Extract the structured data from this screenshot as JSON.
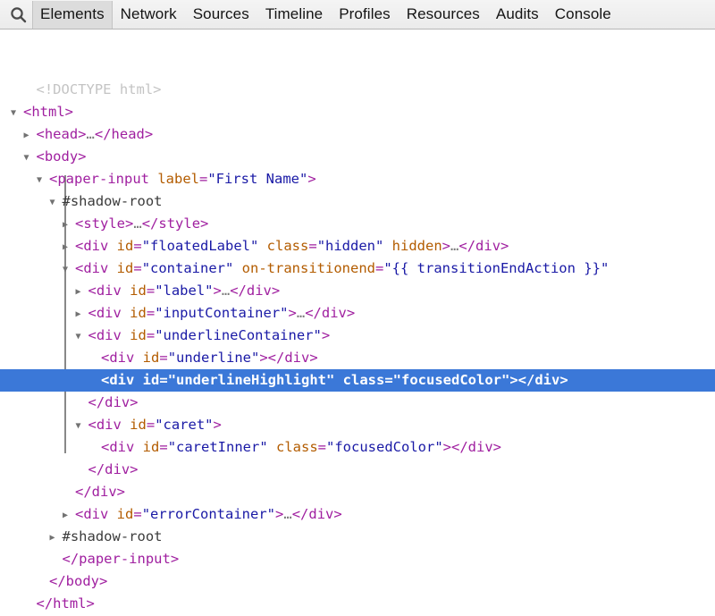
{
  "toolbar": {
    "search_icon": "search-icon",
    "tabs": [
      {
        "label": "Elements",
        "active": true
      },
      {
        "label": "Network",
        "active": false
      },
      {
        "label": "Sources",
        "active": false
      },
      {
        "label": "Timeline",
        "active": false
      },
      {
        "label": "Profiles",
        "active": false
      },
      {
        "label": "Resources",
        "active": false
      },
      {
        "label": "Audits",
        "active": false
      },
      {
        "label": "Console",
        "active": false
      }
    ]
  },
  "colors": {
    "selection_blue": "#3b78d8",
    "tag": "#a020a0",
    "attr_name": "#b35c00",
    "attr_value": "#1a1aa6",
    "doctype_gray": "#c4c4c4",
    "toolbar_bg": "#efefef",
    "active_tab_bg": "#dcdcdc"
  },
  "dom_tree": {
    "lines": [
      {
        "twisty": "",
        "indent": 1,
        "selected": false,
        "parts": [
          {
            "t": "doctype",
            "v": "<!DOCTYPE html>"
          }
        ]
      },
      {
        "twisty": "open",
        "indent": 0,
        "selected": false,
        "parts": [
          {
            "t": "punct",
            "v": "<"
          },
          {
            "t": "tag",
            "v": "html"
          },
          {
            "t": "punct",
            "v": ">"
          }
        ]
      },
      {
        "twisty": "closed",
        "indent": 1,
        "selected": false,
        "parts": [
          {
            "t": "punct",
            "v": "<"
          },
          {
            "t": "tag",
            "v": "head"
          },
          {
            "t": "punct",
            "v": ">"
          },
          {
            "t": "ellipsis",
            "v": "…"
          },
          {
            "t": "punct",
            "v": "</"
          },
          {
            "t": "tag",
            "v": "head"
          },
          {
            "t": "punct",
            "v": ">"
          }
        ]
      },
      {
        "twisty": "open",
        "indent": 1,
        "selected": false,
        "parts": [
          {
            "t": "punct",
            "v": "<"
          },
          {
            "t": "tag",
            "v": "body"
          },
          {
            "t": "punct",
            "v": ">"
          }
        ]
      },
      {
        "twisty": "open",
        "indent": 2,
        "selected": false,
        "parts": [
          {
            "t": "punct",
            "v": "<"
          },
          {
            "t": "tag",
            "v": "paper-input"
          },
          {
            "t": "attr-name",
            "v": " label"
          },
          {
            "t": "punct",
            "v": "="
          },
          {
            "t": "attr-value",
            "v": "\"First Name\""
          },
          {
            "t": "punct",
            "v": ">"
          }
        ]
      },
      {
        "twisty": "open",
        "indent": 3,
        "selected": false,
        "parts": [
          {
            "t": "shadow",
            "v": "#shadow-root"
          }
        ]
      },
      {
        "twisty": "closed",
        "indent": 4,
        "selected": false,
        "parts": [
          {
            "t": "punct",
            "v": "<"
          },
          {
            "t": "tag",
            "v": "style"
          },
          {
            "t": "punct",
            "v": ">"
          },
          {
            "t": "ellipsis",
            "v": "…"
          },
          {
            "t": "punct",
            "v": "</"
          },
          {
            "t": "tag",
            "v": "style"
          },
          {
            "t": "punct",
            "v": ">"
          }
        ]
      },
      {
        "twisty": "closed",
        "indent": 4,
        "selected": false,
        "parts": [
          {
            "t": "punct",
            "v": "<"
          },
          {
            "t": "tag",
            "v": "div"
          },
          {
            "t": "attr-name",
            "v": " id"
          },
          {
            "t": "punct",
            "v": "="
          },
          {
            "t": "attr-value",
            "v": "\"floatedLabel\""
          },
          {
            "t": "attr-name",
            "v": " class"
          },
          {
            "t": "punct",
            "v": "="
          },
          {
            "t": "attr-value",
            "v": "\"hidden\""
          },
          {
            "t": "attr-name",
            "v": " hidden"
          },
          {
            "t": "punct",
            "v": ">"
          },
          {
            "t": "ellipsis",
            "v": "…"
          },
          {
            "t": "punct",
            "v": "</"
          },
          {
            "t": "tag",
            "v": "div"
          },
          {
            "t": "punct",
            "v": ">"
          }
        ]
      },
      {
        "twisty": "open",
        "indent": 4,
        "selected": false,
        "parts": [
          {
            "t": "punct",
            "v": "<"
          },
          {
            "t": "tag",
            "v": "div"
          },
          {
            "t": "attr-name",
            "v": " id"
          },
          {
            "t": "punct",
            "v": "="
          },
          {
            "t": "attr-value",
            "v": "\"container\""
          },
          {
            "t": "attr-name",
            "v": " on-transitionend"
          },
          {
            "t": "punct",
            "v": "="
          },
          {
            "t": "attr-value",
            "v": "\"{{ transitionEndAction }}\""
          }
        ]
      },
      {
        "twisty": "closed",
        "indent": 5,
        "selected": false,
        "parts": [
          {
            "t": "punct",
            "v": "<"
          },
          {
            "t": "tag",
            "v": "div"
          },
          {
            "t": "attr-name",
            "v": " id"
          },
          {
            "t": "punct",
            "v": "="
          },
          {
            "t": "attr-value",
            "v": "\"label\""
          },
          {
            "t": "punct",
            "v": ">"
          },
          {
            "t": "ellipsis",
            "v": "…"
          },
          {
            "t": "punct",
            "v": "</"
          },
          {
            "t": "tag",
            "v": "div"
          },
          {
            "t": "punct",
            "v": ">"
          }
        ]
      },
      {
        "twisty": "closed",
        "indent": 5,
        "selected": false,
        "parts": [
          {
            "t": "punct",
            "v": "<"
          },
          {
            "t": "tag",
            "v": "div"
          },
          {
            "t": "attr-name",
            "v": " id"
          },
          {
            "t": "punct",
            "v": "="
          },
          {
            "t": "attr-value",
            "v": "\"inputContainer\""
          },
          {
            "t": "punct",
            "v": ">"
          },
          {
            "t": "ellipsis",
            "v": "…"
          },
          {
            "t": "punct",
            "v": "</"
          },
          {
            "t": "tag",
            "v": "div"
          },
          {
            "t": "punct",
            "v": ">"
          }
        ]
      },
      {
        "twisty": "open",
        "indent": 5,
        "selected": false,
        "parts": [
          {
            "t": "punct",
            "v": "<"
          },
          {
            "t": "tag",
            "v": "div"
          },
          {
            "t": "attr-name",
            "v": " id"
          },
          {
            "t": "punct",
            "v": "="
          },
          {
            "t": "attr-value",
            "v": "\"underlineContainer\""
          },
          {
            "t": "punct",
            "v": ">"
          }
        ]
      },
      {
        "twisty": "",
        "indent": 6,
        "selected": false,
        "parts": [
          {
            "t": "punct",
            "v": "<"
          },
          {
            "t": "tag",
            "v": "div"
          },
          {
            "t": "attr-name",
            "v": " id"
          },
          {
            "t": "punct",
            "v": "="
          },
          {
            "t": "attr-value",
            "v": "\"underline\""
          },
          {
            "t": "punct",
            "v": "></"
          },
          {
            "t": "tag",
            "v": "div"
          },
          {
            "t": "punct",
            "v": ">"
          }
        ]
      },
      {
        "twisty": "",
        "indent": 6,
        "selected": true,
        "parts": [
          {
            "t": "punct",
            "v": "<"
          },
          {
            "t": "tag",
            "v": "div"
          },
          {
            "t": "attr-name",
            "v": " id"
          },
          {
            "t": "punct",
            "v": "="
          },
          {
            "t": "attr-value",
            "v": "\"underlineHighlight\""
          },
          {
            "t": "attr-name",
            "v": " class"
          },
          {
            "t": "punct",
            "v": "="
          },
          {
            "t": "attr-value",
            "v": "\"focusedColor\""
          },
          {
            "t": "punct",
            "v": "></"
          },
          {
            "t": "tag",
            "v": "div"
          },
          {
            "t": "punct",
            "v": ">"
          }
        ]
      },
      {
        "twisty": "",
        "indent": 5,
        "selected": false,
        "parts": [
          {
            "t": "punct",
            "v": "</"
          },
          {
            "t": "tag",
            "v": "div"
          },
          {
            "t": "punct",
            "v": ">"
          }
        ]
      },
      {
        "twisty": "open",
        "indent": 5,
        "selected": false,
        "parts": [
          {
            "t": "punct",
            "v": "<"
          },
          {
            "t": "tag",
            "v": "div"
          },
          {
            "t": "attr-name",
            "v": " id"
          },
          {
            "t": "punct",
            "v": "="
          },
          {
            "t": "attr-value",
            "v": "\"caret\""
          },
          {
            "t": "punct",
            "v": ">"
          }
        ]
      },
      {
        "twisty": "",
        "indent": 6,
        "selected": false,
        "parts": [
          {
            "t": "punct",
            "v": "<"
          },
          {
            "t": "tag",
            "v": "div"
          },
          {
            "t": "attr-name",
            "v": " id"
          },
          {
            "t": "punct",
            "v": "="
          },
          {
            "t": "attr-value",
            "v": "\"caretInner\""
          },
          {
            "t": "attr-name",
            "v": " class"
          },
          {
            "t": "punct",
            "v": "="
          },
          {
            "t": "attr-value",
            "v": "\"focusedColor\""
          },
          {
            "t": "punct",
            "v": "></"
          },
          {
            "t": "tag",
            "v": "div"
          },
          {
            "t": "punct",
            "v": ">"
          }
        ]
      },
      {
        "twisty": "",
        "indent": 5,
        "selected": false,
        "parts": [
          {
            "t": "punct",
            "v": "</"
          },
          {
            "t": "tag",
            "v": "div"
          },
          {
            "t": "punct",
            "v": ">"
          }
        ]
      },
      {
        "twisty": "",
        "indent": 4,
        "selected": false,
        "parts": [
          {
            "t": "punct",
            "v": "</"
          },
          {
            "t": "tag",
            "v": "div"
          },
          {
            "t": "punct",
            "v": ">"
          }
        ]
      },
      {
        "twisty": "closed",
        "indent": 4,
        "selected": false,
        "parts": [
          {
            "t": "punct",
            "v": "<"
          },
          {
            "t": "tag",
            "v": "div"
          },
          {
            "t": "attr-name",
            "v": " id"
          },
          {
            "t": "punct",
            "v": "="
          },
          {
            "t": "attr-value",
            "v": "\"errorContainer\""
          },
          {
            "t": "punct",
            "v": ">"
          },
          {
            "t": "ellipsis",
            "v": "…"
          },
          {
            "t": "punct",
            "v": "</"
          },
          {
            "t": "tag",
            "v": "div"
          },
          {
            "t": "punct",
            "v": ">"
          }
        ]
      },
      {
        "twisty": "closed",
        "indent": 3,
        "selected": false,
        "parts": [
          {
            "t": "shadow",
            "v": "#shadow-root"
          }
        ]
      },
      {
        "twisty": "",
        "indent": 3,
        "selected": false,
        "parts": [
          {
            "t": "punct",
            "v": "</"
          },
          {
            "t": "tag",
            "v": "paper-input"
          },
          {
            "t": "punct",
            "v": ">"
          }
        ]
      },
      {
        "twisty": "",
        "indent": 2,
        "selected": false,
        "parts": [
          {
            "t": "punct",
            "v": "</"
          },
          {
            "t": "tag",
            "v": "body"
          },
          {
            "t": "punct",
            "v": ">"
          }
        ]
      },
      {
        "twisty": "",
        "indent": 1,
        "selected": false,
        "parts": [
          {
            "t": "punct",
            "v": "</"
          },
          {
            "t": "tag",
            "v": "html"
          },
          {
            "t": "punct",
            "v": ">"
          }
        ]
      }
    ]
  }
}
